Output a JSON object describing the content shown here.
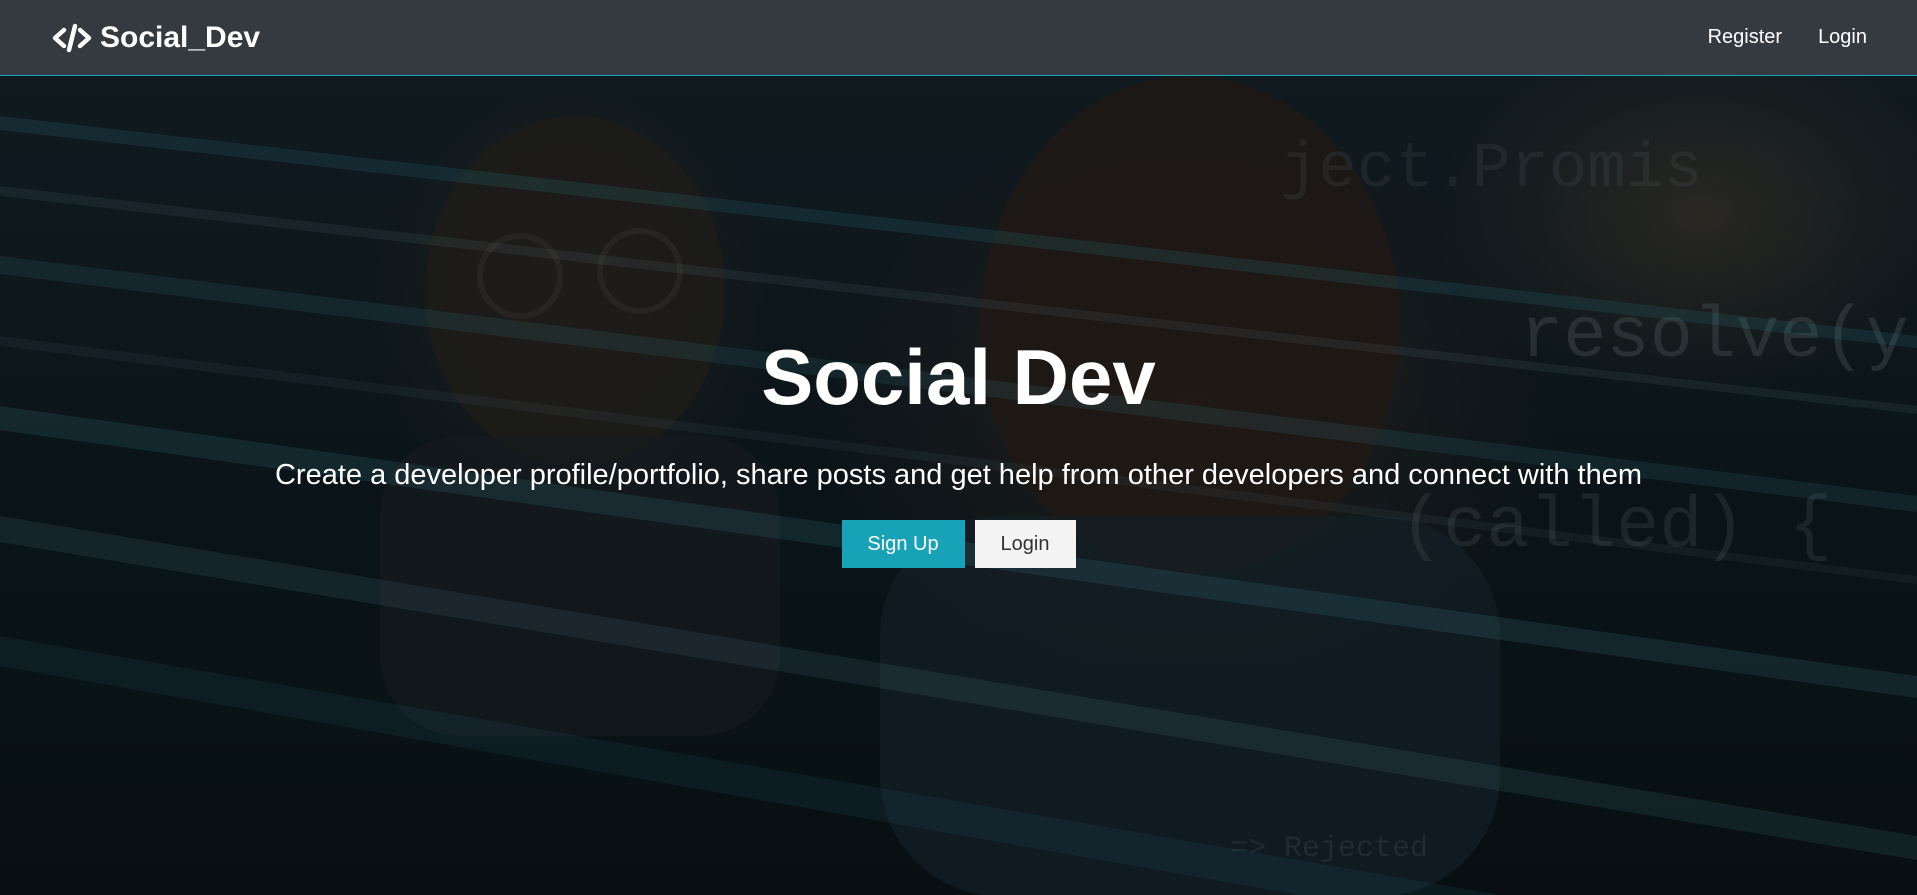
{
  "navbar": {
    "brand": "Social_Dev",
    "brand_icon": "code-icon",
    "links": [
      {
        "label": "Register"
      },
      {
        "label": "Login"
      }
    ],
    "accent_color": "#17a2b8",
    "background_color": "#343a40"
  },
  "hero": {
    "title": "Social Dev",
    "lead": "Create a developer profile/portfolio, share posts and get help from other developers and connect with them",
    "buttons": {
      "signup_label": "Sign Up",
      "login_label": "Login"
    },
    "background_image": "two developers in front of code"
  }
}
